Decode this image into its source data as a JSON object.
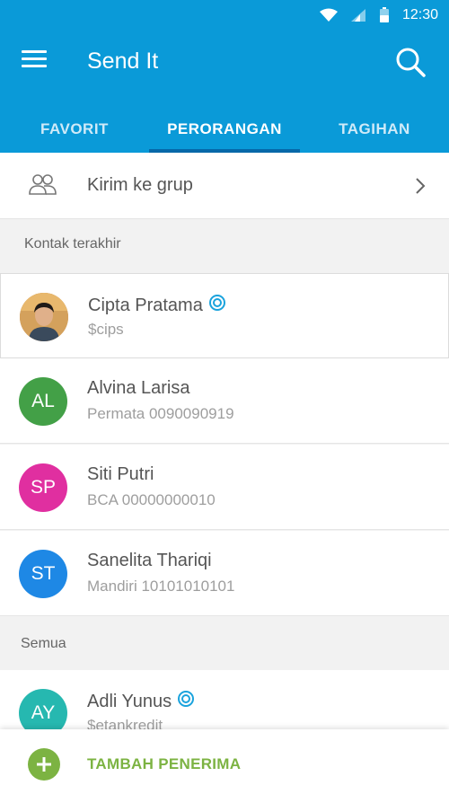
{
  "status_bar": {
    "time": "12:30",
    "icons": [
      "wifi-icon",
      "signal-icon",
      "battery-icon"
    ]
  },
  "app": {
    "title": "Send It"
  },
  "tabs": [
    {
      "label": "FAVORIT",
      "active": false
    },
    {
      "label": "PERORANGAN",
      "active": true
    },
    {
      "label": "TAGIHAN",
      "active": false
    }
  ],
  "group_row": {
    "label": "Kirim ke grup",
    "icon": "group-icon"
  },
  "sections": {
    "recent": "Kontak terakhir",
    "all": "Semua"
  },
  "recent_contacts": [
    {
      "name": "Cipta Pratama",
      "sub": "$cips",
      "avatar_type": "photo",
      "verified": true
    },
    {
      "name": "Alvina Larisa",
      "sub": "Permata 0090090919",
      "initials": "AL",
      "color": "#43a047"
    },
    {
      "name": "Siti Putri",
      "sub": "BCA 00000000010",
      "initials": "SP",
      "color": "#e02fa0"
    },
    {
      "name": "Sanelita Thariqi",
      "sub": "Mandiri 10101010101",
      "initials": "ST",
      "color": "#1e88e5"
    }
  ],
  "all_contacts": [
    {
      "name": "Adli Yunus",
      "sub": "$etankredit",
      "initials": "AY",
      "color": "#26b8b0",
      "verified": true
    }
  ],
  "bottom_action": {
    "label": "TAMBAH PENERIMA"
  },
  "colors": {
    "primary": "#0a9ad8",
    "tab_indicator": "#0668a8",
    "accent_green": "#7cb342",
    "verified": "#1aa3dd"
  }
}
